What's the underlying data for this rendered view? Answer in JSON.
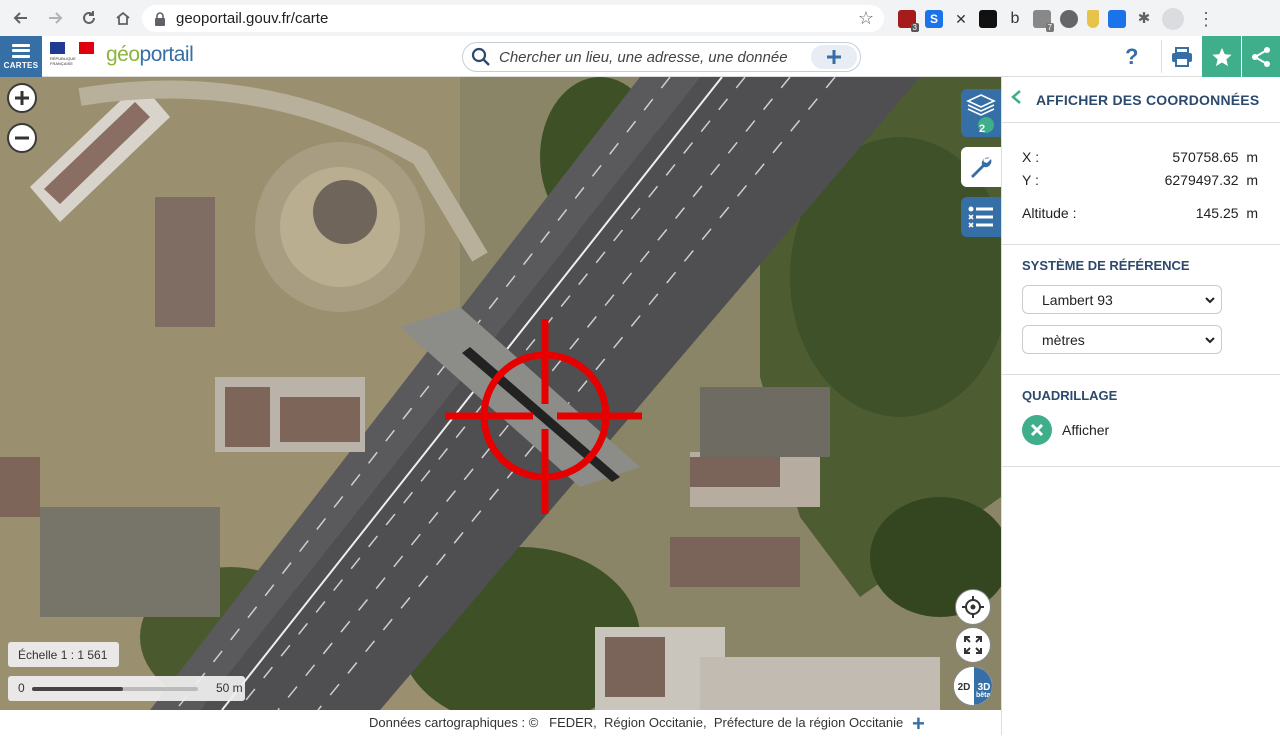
{
  "browser": {
    "url": "geoportail.gouv.fr/carte",
    "extension_badges": [
      "3",
      "7"
    ]
  },
  "header": {
    "cartes_label": "CARTES",
    "logo_text": "RÉPUBLIQUE FRANÇAISE",
    "brand_prefix": "géo",
    "brand_suffix": "portail",
    "search_placeholder": "Chercher un lieu, une adresse, une donnée",
    "help_label": "?"
  },
  "map": {
    "layers_count": "2",
    "scale_label": "Échelle 1 : 1 561",
    "scalebar_start": "0",
    "scalebar_end": "50 m",
    "mode_2d": "2D",
    "mode_3d": "3D",
    "beta": "bêta"
  },
  "footer": {
    "attribution": "Données cartographiques : ©   FEDER,  Région Occitanie,  Préfecture de la région Occitanie",
    "expand_label": "+"
  },
  "panel": {
    "title": "AFFICHER DES COORDONNÉES",
    "x_label": "X :",
    "x_value": "570758.65  m",
    "y_label": "Y :",
    "y_value": "6279497.32  m",
    "alt_label": "Altitude :",
    "alt_value": "145.25  m",
    "ref_heading": "SYSTÈME DE RÉFÉRENCE",
    "ref_system": "Lambert 93",
    "units": "mètres",
    "grid_heading": "QUADRILLAGE",
    "grid_toggle_label": "Afficher"
  },
  "colors": {
    "brand_blue": "#366fa5",
    "accent_green": "#3fae8a",
    "crosshair_red": "#e60000"
  }
}
